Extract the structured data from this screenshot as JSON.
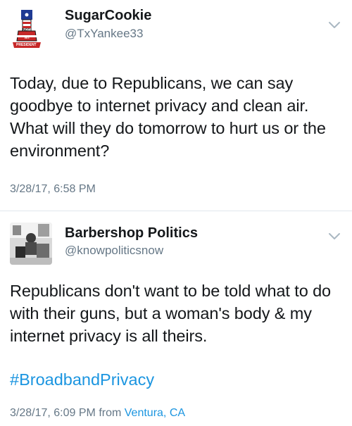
{
  "tweets": [
    {
      "display_name": "SugarCookie",
      "handle": "@TxYankee33",
      "text": "Today, due to Republicans, we can say goodbye to internet privacy and clean air. What will they do tomorrow to hurt us or the environment?",
      "timestamp": "3/28/17, 6:58 PM",
      "avatar": {
        "badge_top": "NOT",
        "badge_mid": "MY",
        "banner": "PRESIDENT"
      }
    },
    {
      "display_name": "Barbershop Politics",
      "handle": "@knowpoliticsnow",
      "text": "Republicans don't want to be told what to do with their guns, but a woman's body & my internet privacy is all theirs.",
      "hashtag": "#BroadbandPrivacy",
      "timestamp": "3/28/17, 6:09 PM",
      "from_label": "from",
      "location": "Ventura, CA"
    }
  ],
  "colors": {
    "link": "#1b95e0",
    "secondary": "#657786",
    "text": "#14171a"
  },
  "icons": {
    "menu": "chevron-down-icon"
  }
}
